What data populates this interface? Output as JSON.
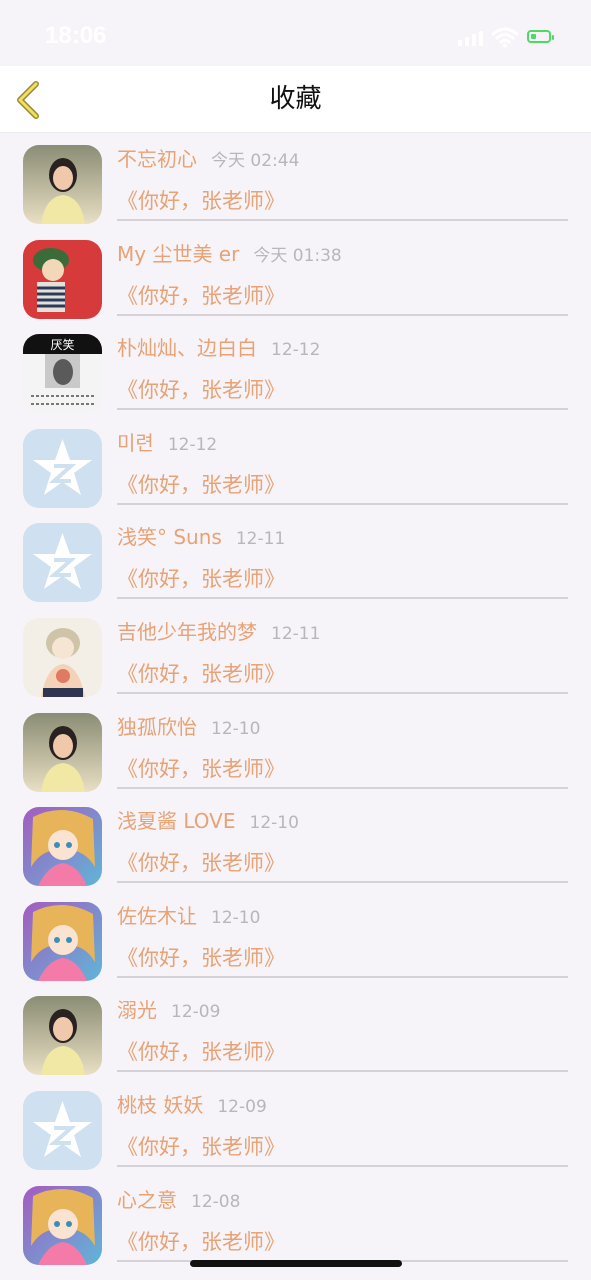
{
  "status_bar": {
    "time": "18:06",
    "battery_color": "#4cd964"
  },
  "nav": {
    "back_icon": "chevron-left-icon",
    "title": "收藏"
  },
  "theme": {
    "accent": "#e8a275",
    "muted": "#b9b6ba",
    "divider": "#d4d2d6"
  },
  "items": [
    {
      "name": "不忘初心",
      "time": "今天 02:44",
      "message": "《你好，张老师》",
      "avatar": "photo"
    },
    {
      "name": "My 尘世美 er",
      "time": "今天 01:38",
      "message": "《你好，张老师》",
      "avatar": "cartoon"
    },
    {
      "name": "朴灿灿、边白白",
      "time": "12-12",
      "message": "《你好，张老师》",
      "avatar": "photo-text"
    },
    {
      "name": "미련",
      "time": "12-12",
      "message": "《你好，张老师》",
      "avatar": "default-qq"
    },
    {
      "name": "浅笑° Suns",
      "time": "12-11",
      "message": "《你好，张老师》",
      "avatar": "default-qq"
    },
    {
      "name": "吉他少年我的梦",
      "time": "12-11",
      "message": "《你好，张老师》",
      "avatar": "illustration"
    },
    {
      "name": "独孤欣怡",
      "time": "12-10",
      "message": "《你好，张老师》",
      "avatar": "photo"
    },
    {
      "name": "浅夏酱 LOVE",
      "time": "12-10",
      "message": "《你好，张老师》",
      "avatar": "anime"
    },
    {
      "name": "佐佐木让",
      "time": "12-10",
      "message": "《你好，张老师》",
      "avatar": "anime"
    },
    {
      "name": "溺光",
      "time": "12-09",
      "message": "《你好，张老师》",
      "avatar": "photo"
    },
    {
      "name": "桃枝 妖妖",
      "time": "12-09",
      "message": "《你好，张老师》",
      "avatar": "default-qq"
    },
    {
      "name": "心之意",
      "time": "12-08",
      "message": "《你好，张老师》",
      "avatar": "anime"
    }
  ]
}
